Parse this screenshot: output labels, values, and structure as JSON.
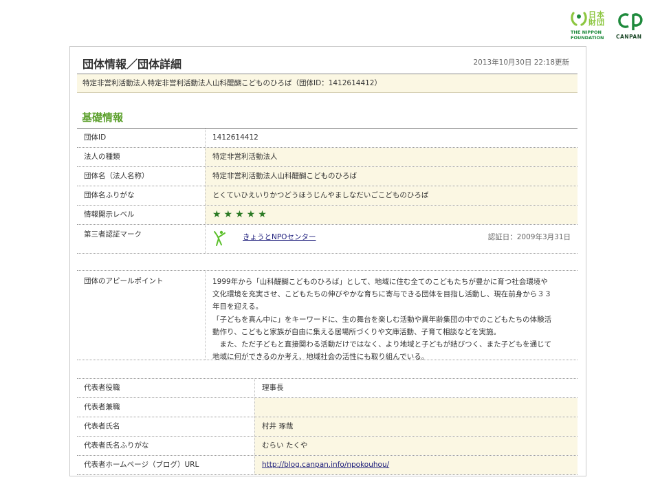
{
  "logos": {
    "nippon_foundation": {
      "jp": "日本財団",
      "en_line1": "THE NIPPON",
      "en_line2": "FOUNDATION"
    },
    "canpan": {
      "text": "CANPAN"
    }
  },
  "header": {
    "title": "団体情報／団体詳細",
    "updated": "2013年10月30日 22:18更新",
    "org_line": "特定非営利活動法人特定非営利活動法人山科醍醐こどものひろば（団体ID：1412614412）"
  },
  "basic_info": {
    "section_title": "基礎情報",
    "rows": [
      {
        "label": "団体ID",
        "value": "1412614412"
      },
      {
        "label": "法人の種類",
        "value": "特定非営利活動法人"
      },
      {
        "label": "団体名（法人名称）",
        "value": "特定非営利活動法人山科醍醐こどものひろば"
      },
      {
        "label": "団体名ふりがな",
        "value": "とくていひえいりかつどうほうじんやましなだいごこどものひろば"
      },
      {
        "label": "情報開示レベル",
        "value": "★★★★★",
        "level": 5
      },
      {
        "label": "第三者認証マーク"
      }
    ],
    "certification": {
      "org": "きょうとNPOセンター",
      "date": "認証日：2009年3月31日",
      "icon": "kyoto-npo-center-mark-icon"
    }
  },
  "appeal": {
    "label": "団体のアピールポイント",
    "lines": [
      "1999年から「山科醍醐こどものひろば」として、地域に住む全てのこどもたちが豊かに育つ社会環境や",
      "文化環境を充実させ、こどもたちの伸びやかな育ちに寄与できる団体を目指し活動し、現在前身から３３",
      "年目を迎える。",
      "「子どもを真ん中に」をキーワードに、生の舞台を楽しむ活動や異年齢集団の中でのこどもたちの体験活",
      "動作り、こどもと家族が自由に集える居場所づくりや文庫活動、子育て相談などを実施。",
      "　また、ただ子どもと直接関わる活動だけではなく、より地域と子どもが結びつく、また子どもを通じて",
      "地域に何ができるのか考え、地域社会の活性にも取り組んでいる。"
    ]
  },
  "representative": {
    "rows": [
      {
        "label": "代表者役職",
        "value": "理事長"
      },
      {
        "label": "代表者兼職",
        "value": ""
      },
      {
        "label": "代表者氏名",
        "value": "村井 琢哉"
      },
      {
        "label": "代表者氏名ふりがな",
        "value": "むらい たくや"
      },
      {
        "label": "代表者ホームページ（ブログ）URL",
        "value": "http://blog.canpan.info/npokouhou/"
      }
    ]
  },
  "colors": {
    "accent_green": "#5a9f2a",
    "row_bg": "#fbf7e3",
    "link": "#1a1a7a",
    "star": "#2b7a24"
  }
}
